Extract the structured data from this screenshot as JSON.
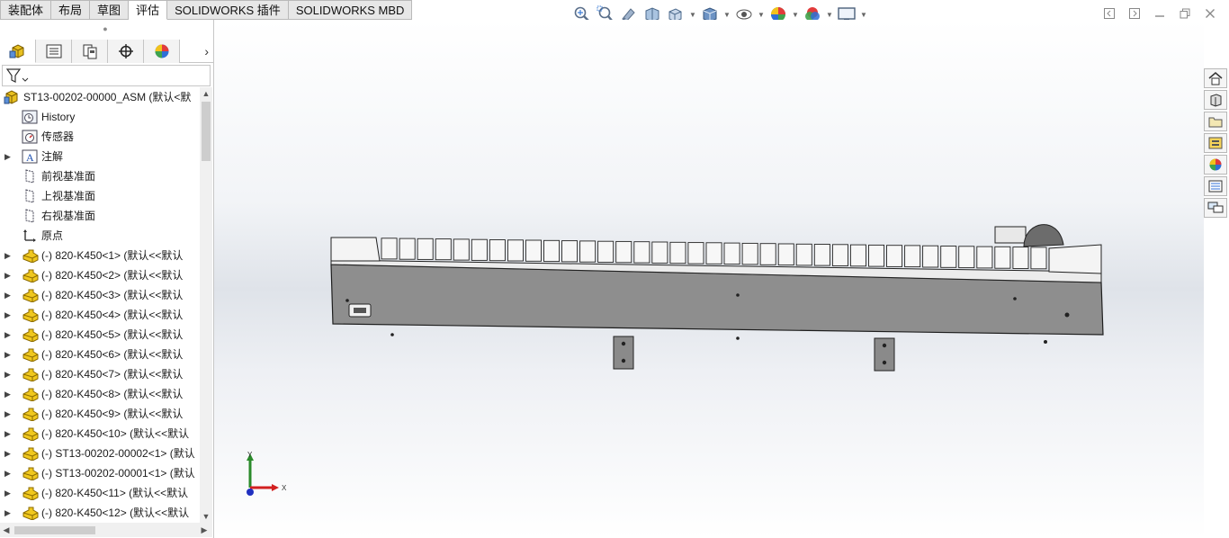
{
  "tabs": [
    "装配体",
    "布局",
    "草图",
    "评估",
    "SOLIDWORKS 插件",
    "SOLIDWORKS MBD"
  ],
  "active_tab_index": 3,
  "heads_up_toolbar": [
    "zoom-to-fit-icon",
    "zoom-to-area-icon",
    "previous-view-icon",
    "section-view-icon",
    "view-orientation-icon",
    "display-style-icon",
    "hide-show-items-icon",
    "edit-appearance-icon",
    "apply-scene-icon",
    "view-settings-icon"
  ],
  "feature_tree": {
    "tabs": [
      "featuremanager-icon",
      "propertymanager-icon",
      "configurationmanager-icon",
      "dimxpert-icon",
      "display-manager-icon"
    ],
    "root": "ST13-00202-00000_ASM  (默认<默",
    "items": [
      {
        "label": "History",
        "icon": "history-icon",
        "expandable": false
      },
      {
        "label": "传感器",
        "icon": "sensor-icon",
        "expandable": false
      },
      {
        "label": "注解",
        "icon": "annotation-icon",
        "expandable": true
      },
      {
        "label": "前视基准面",
        "icon": "plane-icon",
        "expandable": false
      },
      {
        "label": "上视基准面",
        "icon": "plane-icon",
        "expandable": false
      },
      {
        "label": "右视基准面",
        "icon": "plane-icon",
        "expandable": false
      },
      {
        "label": "原点",
        "icon": "origin-icon",
        "expandable": false
      },
      {
        "label": "(-) 820-K450<1>  (默认<<默认",
        "icon": "part-icon",
        "expandable": true
      },
      {
        "label": "(-) 820-K450<2>  (默认<<默认",
        "icon": "part-icon",
        "expandable": true
      },
      {
        "label": "(-) 820-K450<3>  (默认<<默认",
        "icon": "part-icon",
        "expandable": true
      },
      {
        "label": "(-) 820-K450<4>  (默认<<默认",
        "icon": "part-icon",
        "expandable": true
      },
      {
        "label": "(-) 820-K450<5>  (默认<<默认",
        "icon": "part-icon",
        "expandable": true
      },
      {
        "label": "(-) 820-K450<6>  (默认<<默认",
        "icon": "part-icon",
        "expandable": true
      },
      {
        "label": "(-) 820-K450<7>  (默认<<默认",
        "icon": "part-icon",
        "expandable": true
      },
      {
        "label": "(-) 820-K450<8>  (默认<<默认",
        "icon": "part-icon",
        "expandable": true
      },
      {
        "label": "(-) 820-K450<9>  (默认<<默认",
        "icon": "part-icon",
        "expandable": true
      },
      {
        "label": "(-) 820-K450<10>  (默认<<默认",
        "icon": "part-icon",
        "expandable": true
      },
      {
        "label": "(-) ST13-00202-00002<1>  (默认",
        "icon": "part-icon",
        "expandable": true
      },
      {
        "label": "(-) ST13-00202-00001<1>  (默认",
        "icon": "part-icon",
        "expandable": true
      },
      {
        "label": "(-) 820-K450<11>  (默认<<默认",
        "icon": "part-icon",
        "expandable": true
      },
      {
        "label": "(-) 820-K450<12>  (默认<<默认",
        "icon": "part-icon",
        "expandable": true
      }
    ]
  },
  "triad": {
    "y_label": "Y",
    "x_label": "X"
  },
  "task_pane": [
    "home-icon",
    "design-library-icon",
    "file-explorer-icon",
    "view-palette-icon",
    "appearances-icon",
    "custom-properties-icon",
    "forum-icon"
  ],
  "colors": {
    "part_yellow": "#e8c020",
    "model_body": "#8e8e8e",
    "triad_y": "#2a8a2a",
    "triad_x": "#d22020",
    "triad_z": "#2030c0"
  }
}
